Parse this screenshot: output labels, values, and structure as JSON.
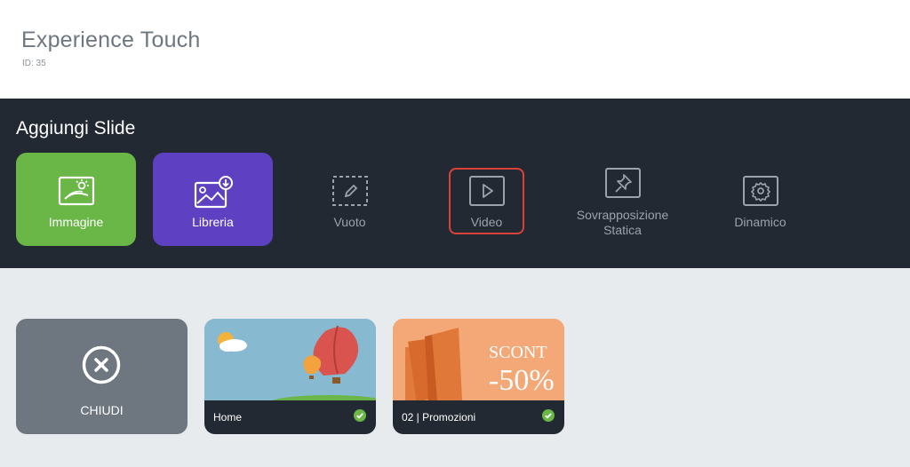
{
  "header": {
    "title": "Experience Touch",
    "id_text": "ID: 35"
  },
  "toolbar": {
    "title": "Aggiungi Slide",
    "tiles": [
      {
        "label": "Immagine",
        "icon": "image-landscape-icon",
        "color": "#6ab647"
      },
      {
        "label": "Libreria",
        "icon": "library-image-download-icon",
        "color": "#5e40c3"
      },
      {
        "label": "Vuoto",
        "icon": "dashed-box-pencil-icon"
      },
      {
        "label": "Video",
        "icon": "play-icon",
        "highlight_color": "#d9413a"
      },
      {
        "label_line1": "Sovrapposizione",
        "label_line2": "Statica",
        "icon": "pin-icon"
      },
      {
        "label": "Dinamico",
        "icon": "gear-icon"
      }
    ]
  },
  "slides": {
    "close": {
      "label": "CHIUDI",
      "icon": "close-circle-icon"
    },
    "items": [
      {
        "name": "Home",
        "status": "published",
        "status_color": "#6ab647"
      },
      {
        "name": "02 | Promozioni",
        "status": "published",
        "status_color": "#6ab647",
        "art_text1": "SCONT",
        "art_text2": "-50%"
      }
    ]
  }
}
